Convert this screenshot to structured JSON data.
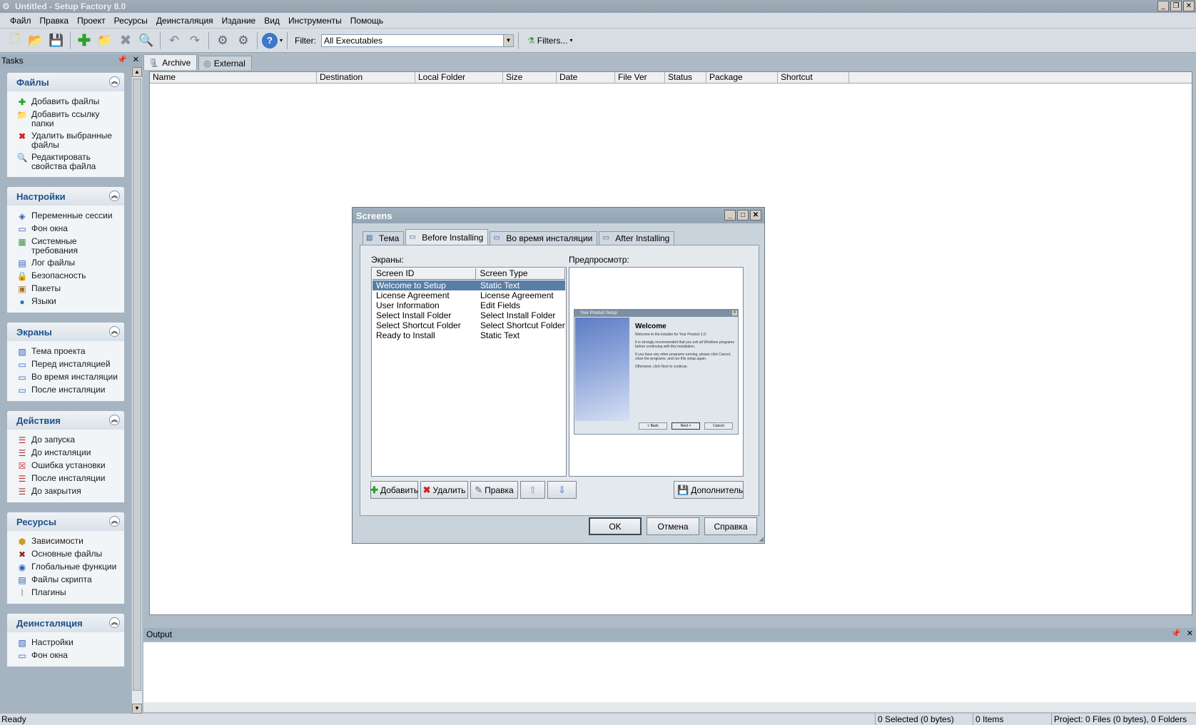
{
  "window": {
    "title": "Untitled - Setup Factory 8.0",
    "controls": [
      "_",
      "❐",
      "✕"
    ]
  },
  "menu": [
    "Файл",
    "Правка",
    "Проект",
    "Ресурсы",
    "Деинсталяция",
    "Издание",
    "Вид",
    "Инструменты",
    "Помощь"
  ],
  "toolbar": {
    "filter_label": "Filter:",
    "filter_value": "All Executables",
    "filters_label": "Filters..."
  },
  "tasks": {
    "title": "Tasks",
    "groups": [
      {
        "title": "Файлы",
        "items": [
          "Добавить файлы",
          "Добавить ссылку папки",
          "Удалить выбранные файлы",
          "Редактировать свойства файла"
        ]
      },
      {
        "title": "Настройки",
        "items": [
          "Переменные сессии",
          "Фон окна",
          "Системные требования",
          "Лог файлы",
          "Безопасность",
          "Пакеты",
          "Языки"
        ]
      },
      {
        "title": "Экраны",
        "items": [
          "Тема проекта",
          "Перед инсталяцией",
          "Во время инсталяции",
          "После инсталяции"
        ]
      },
      {
        "title": "Действия",
        "items": [
          "До запуска",
          "До инсталяции",
          "Ошибка установки",
          "После инсталяции",
          "До закрытия"
        ]
      },
      {
        "title": "Ресурсы",
        "items": [
          "Зависимости",
          "Основные файлы",
          "Глобальные функции",
          "Файлы скрипта",
          "Плагины"
        ]
      },
      {
        "title": "Деинсталяция",
        "items": [
          "Настройки",
          "Фон окна"
        ]
      }
    ]
  },
  "file_tabs": [
    "Archive",
    "External"
  ],
  "columns": [
    "Name",
    "Destination",
    "Local Folder",
    "Size",
    "Date",
    "File Ver",
    "Status",
    "Package",
    "Shortcut"
  ],
  "output": {
    "title": "Output"
  },
  "status": {
    "ready": "Ready",
    "selected": "0 Selected (0 bytes)",
    "items": "0 Items",
    "project": "Project: 0 Files (0 bytes), 0 Folders"
  },
  "dialog": {
    "title": "Screens",
    "tabs": [
      "Тема",
      "Before Installing",
      "Во время инсталяции",
      "After Installing"
    ],
    "screens_label": "Экраны:",
    "preview_label": "Предпросмотр:",
    "list_columns": [
      "Screen ID",
      "Screen Type"
    ],
    "rows": [
      {
        "id": "Welcome to Setup",
        "type": "Static Text"
      },
      {
        "id": "License Agreement",
        "type": "License Agreement"
      },
      {
        "id": "User Information",
        "type": "Edit Fields"
      },
      {
        "id": "Select Install Folder",
        "type": "Select Install Folder"
      },
      {
        "id": "Select Shortcut Folder",
        "type": "Select Shortcut Folder"
      },
      {
        "id": "Ready to Install",
        "type": "Static Text"
      }
    ],
    "preview": {
      "window_title": "Your Product Setup",
      "heading": "Welcome",
      "lines": [
        "Welcome to the installer for Your Product 1.0.",
        "It is strongly recommended that you exit all Windows programs before continuing with this installation.",
        "If you have any other programs running, please click Cancel, close the programs, and run this setup again.",
        "Otherwise, click Next to continue."
      ],
      "buttons": [
        "< Back",
        "Next >",
        "Cancel"
      ]
    },
    "buttons": {
      "add": "Добавить",
      "remove": "Удалить",
      "edit": "Правка",
      "more": "Дополнительно",
      "ok": "OK",
      "cancel": "Отмена",
      "help": "Справка"
    }
  }
}
